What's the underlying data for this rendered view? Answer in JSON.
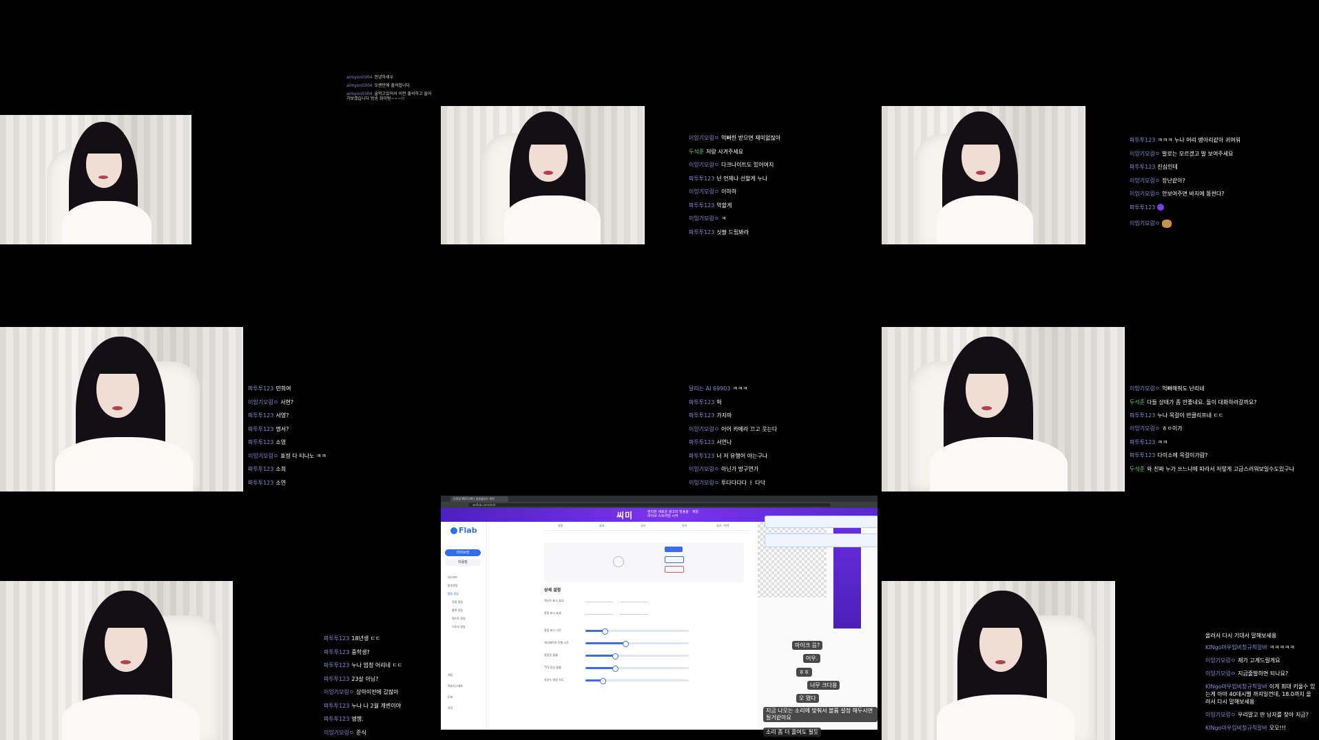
{
  "tiles": [
    {
      "chat": [
        {
          "name": "aimyon0304",
          "text": "안녕하세우"
        },
        {
          "name": "aimyon0304",
          "text": "오랜만에 출석합니다"
        },
        {
          "name": "aimyon0304",
          "text": "술먹고있어서 이런 출석하고 들어가보겠습니다 방송 화이팅~~~!!"
        }
      ]
    },
    {
      "chat": [
        {
          "name": "이잉기모링ㅇ",
          "text": "억빠한 받으면 재미없잖아"
        },
        {
          "name": "두석준",
          "text": "저랑 사겨주세요"
        },
        {
          "name": "이잉기모링ㅇ",
          "text": "다크나이트도 있어여지"
        },
        {
          "name": "파투투123",
          "text": "넌 언제나 선할게 누나"
        },
        {
          "name": "이잉기모링ㅇ",
          "text": "이하하"
        },
        {
          "name": "파투투123",
          "text": "악할게"
        },
        {
          "name": "이잉기모링ㅇ",
          "text": "ㅋ"
        },
        {
          "name": "파투투123",
          "text": "싯팔 드립봐라"
        }
      ]
    },
    {
      "chat": [
        {
          "name": "파투투123",
          "text": "ㅋㅋㅋ 누나 머리 병아리같아 귀여워"
        },
        {
          "name": "이잉기모링ㅇ",
          "text": "발로는 모르겠고 발 보여주세요"
        },
        {
          "name": "파투투123",
          "text": "진심인데"
        },
        {
          "name": "이잉기모링ㅇ",
          "text": "장난같아?"
        },
        {
          "name": "이잉기모링ㅇ",
          "text": "안보여주면 바지에 똥싼다?"
        },
        {
          "name": "파투투123",
          "text": ""
        },
        {
          "name": "이잉기모링ㅇ",
          "text": ""
        }
      ]
    },
    {
      "chat": [
        {
          "name": "파투투123",
          "text": "민희여"
        },
        {
          "name": "이잉기모링ㅇ",
          "text": "서현?"
        },
        {
          "name": "파투투123",
          "text": "서영?"
        },
        {
          "name": "파투투123",
          "text": "명서?"
        },
        {
          "name": "파투투123",
          "text": "소영"
        },
        {
          "name": "이잉기모링ㅇ",
          "text": "표정 다 티나노 ㅋㅋ"
        },
        {
          "name": "파투투123",
          "text": "소희"
        },
        {
          "name": "파투투123",
          "text": "소연"
        }
      ]
    },
    {
      "chat": [
        {
          "name": "달리는 AI 69903",
          "text": "ㅋㅋㅋ"
        },
        {
          "name": "파투투123",
          "text": "헉"
        },
        {
          "name": "파투투123",
          "text": "가지마"
        },
        {
          "name": "이잉기모링ㅇ",
          "text": "어어 카메라 끄고 웃는다"
        },
        {
          "name": "파투투123",
          "text": "서연나"
        },
        {
          "name": "파투투123",
          "text": "너 저 유행어 아는구나"
        },
        {
          "name": "이잉기모링ㅇ",
          "text": "아닌가 방구연가"
        },
        {
          "name": "이잉기모링ㅇ",
          "text": "투다다다다 ㅏ 다닥"
        }
      ]
    },
    {
      "chat": [
        {
          "name": "이잉기모링ㅇ",
          "text": "억빠해줘도 난리네"
        },
        {
          "name": "두석준",
          "text": "다들 상태가 좀 안좋네요. 둘이 대화하려갈까요?"
        },
        {
          "name": "파투투123",
          "text": "누나 목걸이 반클리프네 ㄷㄷ"
        },
        {
          "name": "이잉기모링ㅇ",
          "text": "ㅎㅇ이가"
        },
        {
          "name": "파투투123",
          "text": "ㅋㅋ"
        },
        {
          "name": "파투투123",
          "text": "다이소에 목걸이가람?"
        },
        {
          "name": "두석준",
          "text": "와 진짜 누가 쓰느냐에 따라서 저렇게 고급스러워보일수도있구나"
        }
      ]
    },
    {
      "chat": [
        {
          "name": "파투투123",
          "text": "18년생 ㄷㄷ"
        },
        {
          "name": "파투투123",
          "text": "중학생?"
        },
        {
          "name": "파투투123",
          "text": "누나 엄청 어리네 ㄷㄷ"
        },
        {
          "name": "파투투123",
          "text": "23살 아님?"
        },
        {
          "name": "이잉기모링ㅇ",
          "text": "상하이전에 갔잖아"
        },
        {
          "name": "파투투123",
          "text": "누나 나 2월 개변이야"
        },
        {
          "name": "파투투123",
          "text": "엥헴."
        },
        {
          "name": "이잉기모링ㅇ",
          "text": "준식"
        }
      ]
    },
    {
      "chat": [
        {
          "name": "",
          "text": "올려서 다시 기대서 말해보세용"
        },
        {
          "name": "KINgo마우임비청규칙말바",
          "text": "ㅋㅋㅋㅋㅋ"
        },
        {
          "name": "이잉기모링ㅇ",
          "text": "제가 고계드릴게요"
        },
        {
          "name": "이잉기모링ㅇ",
          "text": "지금줄발하면 되나요?"
        },
        {
          "name": "KINgo마우임비청규칙말바",
          "text": "이게 최대 키울수 있는게 아마 40데시벨 까지일껀데, 18.0까지 올려서 다시 말해보세용"
        },
        {
          "name": "이잉기모링ㅇ",
          "text": "우리말고 딴 남자를 찾아 지금?"
        },
        {
          "name": "KINgo마우임비청규칙말바",
          "text": "오오!!!"
        }
      ]
    }
  ],
  "screen": {
    "browser_tab": "무료방 WEFLAB | 방송플러스 위지",
    "url": "weflab.com/dn/4",
    "banner_logo": "씨미",
    "banner_copy": "편리한 새로운 광고의 방송을 · 게임 라이브 스트리밍 시작",
    "brand": "Flab",
    "sidebar": {
      "primary_button": "라이브방",
      "secondary_button": "미용방",
      "items": [
        "대시보드",
        "방송알림",
        "통합 알림",
        "후원 알림",
        "룰렛 알림",
        "텍스트 알림",
        "이모지 알림",
        "채팅",
        "목표치그래프",
        "투표",
        "자막"
      ]
    },
    "tabs": [
      "설정",
      "효과",
      "공유",
      "자막",
      "효과 · 위젯"
    ],
    "section_title": "상세 설정",
    "rows": [
      {
        "label": "텍스트 표시 효과",
        "value": ""
      },
      {
        "label": "알림 표시 효과",
        "value": ""
      },
      {
        "label": "알림 표시 시간",
        "value": 0.18
      },
      {
        "label": "애니메이션 진행 시간",
        "value": 0.38
      },
      {
        "label": "알림음 볼륨",
        "value": 0.28
      },
      {
        "label": "TTS 음성 볼륨",
        "value": 0.28
      },
      {
        "label": "사운드 재생 속도",
        "value": 0.16
      }
    ],
    "overlay_chat": [
      {
        "text": "마이크 음?"
      },
      {
        "text": "어우."
      },
      {
        "text": "ㅎㅎ"
      },
      {
        "text": "너무 크다용"
      },
      {
        "text": "오 됐다"
      },
      {
        "text": "지금 나오는 소리에 맞춰서 볼륨 설정 해두시면 될거같아요"
      },
      {
        "text": "소리 좀 더 줄여도 될듯"
      }
    ]
  },
  "colors": {
    "chat_name": "#8a8ad8",
    "chat_name_alt": "#69c96a",
    "accent": "#3a6ee8",
    "banner": "#6a2ee0"
  }
}
